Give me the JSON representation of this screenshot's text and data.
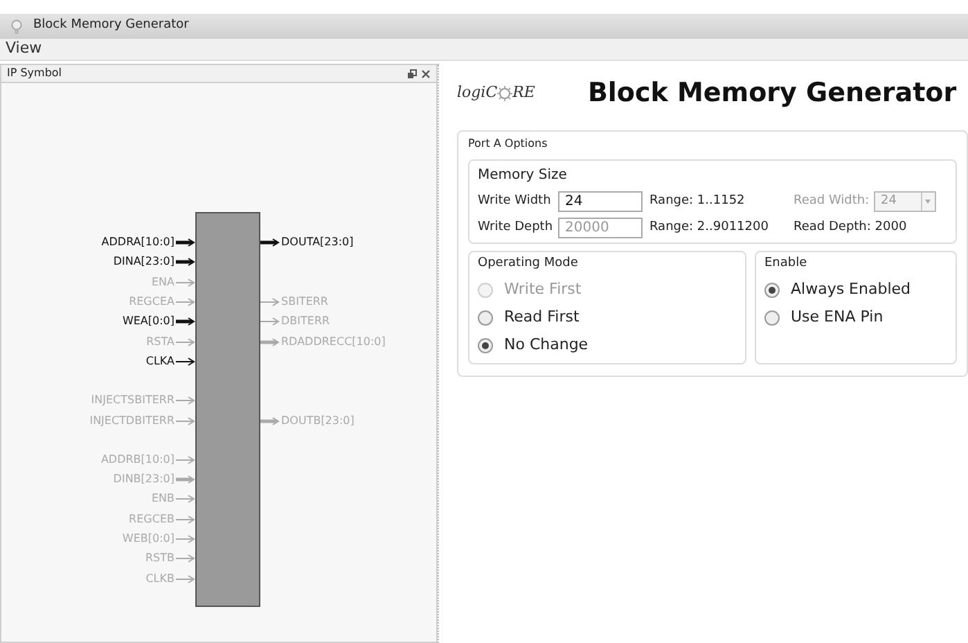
{
  "window": {
    "title": "Block Memory Generator"
  },
  "menu": [
    "View"
  ],
  "symbol_panel": {
    "title": "IP Symbol",
    "groups": [
      [
        {
          "left": {
            "name": "ADDRA[10:0]",
            "active": true,
            "bus": true
          },
          "right": {
            "name": "DOUTA[23:0]",
            "active": true,
            "bus": true
          }
        },
        {
          "left": {
            "name": "DINA[23:0]",
            "active": true,
            "bus": true
          }
        },
        {
          "left": {
            "name": "ENA",
            "active": false,
            "bus": false
          }
        },
        {
          "left": {
            "name": "REGCEA",
            "active": false,
            "bus": false
          },
          "right": {
            "name": "SBITERR",
            "active": false,
            "bus": false
          }
        },
        {
          "left": {
            "name": "WEA[0:0]",
            "active": true,
            "bus": true
          },
          "right": {
            "name": "DBITERR",
            "active": false,
            "bus": false
          }
        },
        {
          "left": {
            "name": "RSTA",
            "active": false,
            "bus": false
          },
          "right": {
            "name": "RDADDRECC[10:0]",
            "active": false,
            "bus": true
          }
        },
        {
          "left": {
            "name": "CLKA",
            "active": true,
            "bus": false
          }
        }
      ],
      [
        {
          "left": {
            "name": "INJECTSBITERR",
            "active": false,
            "bus": false
          }
        },
        {
          "left": {
            "name": "INJECTDBITERR",
            "active": false,
            "bus": false
          },
          "right": {
            "name": "DOUTB[23:0]",
            "active": false,
            "bus": true
          }
        }
      ],
      [
        {
          "left": {
            "name": "ADDRB[10:0]",
            "active": false,
            "bus": false
          }
        },
        {
          "left": {
            "name": "DINB[23:0]",
            "active": false,
            "bus": true
          }
        },
        {
          "left": {
            "name": "ENB",
            "active": false,
            "bus": false
          }
        },
        {
          "left": {
            "name": "REGCEB",
            "active": false,
            "bus": false
          }
        },
        {
          "left": {
            "name": "WEB[0:0]",
            "active": false,
            "bus": false
          }
        },
        {
          "left": {
            "name": "RSTB",
            "active": false,
            "bus": false
          }
        },
        {
          "left": {
            "name": "CLKB",
            "active": false,
            "bus": false
          }
        }
      ]
    ]
  },
  "logo": {
    "prefix": "logiC",
    "suffix": "RE"
  },
  "heading": "Block Memory Generator",
  "port_a": {
    "title": "Port A Options",
    "memory_size": {
      "title": "Memory Size",
      "write_width": {
        "label": "Write Width",
        "value": "24",
        "disabled": false,
        "range": "Range: 1..1152"
      },
      "read_width": {
        "label": "Read Width:",
        "value": "24",
        "disabled": true
      },
      "write_depth": {
        "label": "Write Depth",
        "value": "20000",
        "disabled": true,
        "range": "Range: 2..9011200"
      },
      "read_depth": "Read Depth: 2000"
    },
    "operating_mode": {
      "title": "Operating Mode",
      "options": [
        {
          "label": "Write First",
          "selected": false,
          "disabled": true
        },
        {
          "label": "Read First",
          "selected": false,
          "disabled": false
        },
        {
          "label": "No Change",
          "selected": true,
          "disabled": false
        }
      ]
    },
    "enable": {
      "title": "Enable",
      "options": [
        {
          "label": "Always Enabled",
          "selected": true,
          "disabled": false
        },
        {
          "label": "Use ENA Pin",
          "selected": false,
          "disabled": false
        }
      ]
    }
  }
}
